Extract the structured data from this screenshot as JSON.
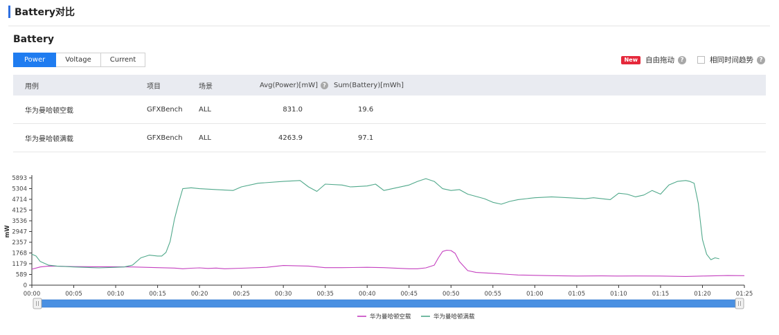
{
  "page": {
    "title": "Battery对比"
  },
  "section": {
    "title": "Battery"
  },
  "tabs": [
    {
      "label": "Power",
      "active": true
    },
    {
      "label": "Voltage",
      "active": false
    },
    {
      "label": "Current",
      "active": false
    }
  ],
  "tools": {
    "new_badge": "New",
    "free_drag_label": "自由拖动",
    "same_time_label": "相同时间趋势"
  },
  "table": {
    "headers": [
      "用例",
      "项目",
      "场景",
      "Avg(Power)[mW]",
      "Sum(Battery)[mWh]"
    ],
    "rows": [
      [
        "华为曼哈顿空载",
        "GFXBench",
        "ALL",
        "831.0",
        "19.6"
      ],
      [
        "华为曼哈顿满载",
        "GFXBench",
        "ALL",
        "4263.9",
        "97.1"
      ]
    ]
  },
  "chart_data": {
    "type": "line",
    "ylabel": "mW",
    "ylim": [
      0,
      5893
    ],
    "yticks": [
      0,
      589,
      1179,
      1768,
      2357,
      2947,
      3536,
      4125,
      4714,
      5304,
      5893
    ],
    "xlim": [
      0,
      85
    ],
    "xticks": [
      "00:00",
      "00:05",
      "00:10",
      "00:15",
      "00:20",
      "00:25",
      "00:30",
      "00:35",
      "00:40",
      "00:45",
      "00:50",
      "00:55",
      "01:00",
      "01:05",
      "01:10",
      "01:15",
      "01:20",
      "01:25"
    ],
    "legend_position": "bottom-center",
    "grid": false,
    "series": [
      {
        "name": "华为曼哈顿空载",
        "color": "#c43fbf",
        "x": [
          0,
          1,
          2,
          3,
          5,
          8,
          10,
          12,
          15,
          17,
          18,
          19,
          20,
          21,
          22,
          23,
          25,
          28,
          30,
          33,
          35,
          37,
          40,
          42,
          45,
          46,
          47,
          48,
          48.5,
          49,
          49.5,
          50,
          50.5,
          51,
          52,
          53,
          55,
          57,
          58,
          60,
          62,
          65,
          68,
          70,
          72,
          75,
          78,
          80,
          83,
          85
        ],
        "y": [
          880,
          1000,
          1050,
          1040,
          1020,
          1010,
          1010,
          1000,
          960,
          940,
          900,
          930,
          950,
          920,
          940,
          900,
          930,
          980,
          1080,
          1050,
          960,
          960,
          980,
          960,
          900,
          900,
          950,
          1100,
          1500,
          1850,
          1920,
          1900,
          1750,
          1300,
          800,
          700,
          650,
          590,
          560,
          540,
          520,
          500,
          510,
          500,
          505,
          500,
          480,
          500,
          530,
          520
        ]
      },
      {
        "name": "华为曼哈顿满载",
        "color": "#4fa88a",
        "x": [
          0,
          0.5,
          1,
          2,
          3,
          5,
          8,
          10,
          11,
          12,
          13,
          14,
          15,
          15.5,
          16,
          16.5,
          17,
          17.5,
          18,
          19,
          20,
          22,
          24,
          25,
          27,
          30,
          32,
          33,
          34,
          35,
          37,
          38,
          40,
          41,
          42,
          43,
          45,
          46,
          47,
          48,
          49,
          50,
          51,
          52,
          54,
          55,
          56,
          57,
          58,
          60,
          62,
          64,
          66,
          67,
          68,
          69,
          70,
          71,
          72,
          73,
          74,
          75,
          76,
          77,
          78,
          78.5,
          79,
          79.5,
          80,
          80.5,
          81,
          81.5,
          82
        ],
        "y": [
          1700,
          1600,
          1300,
          1100,
          1050,
          1000,
          950,
          980,
          1000,
          1100,
          1500,
          1650,
          1600,
          1600,
          1800,
          2400,
          3600,
          4500,
          5300,
          5350,
          5300,
          5250,
          5200,
          5400,
          5600,
          5700,
          5750,
          5400,
          5150,
          5550,
          5500,
          5400,
          5450,
          5550,
          5200,
          5300,
          5500,
          5700,
          5850,
          5700,
          5300,
          5200,
          5250,
          5000,
          4750,
          4550,
          4450,
          4600,
          4700,
          4800,
          4850,
          4800,
          4750,
          4800,
          4750,
          4700,
          5050,
          5000,
          4850,
          4950,
          5200,
          5000,
          5500,
          5700,
          5750,
          5700,
          5600,
          4500,
          2500,
          1700,
          1400,
          1500,
          1450
        ]
      }
    ]
  }
}
